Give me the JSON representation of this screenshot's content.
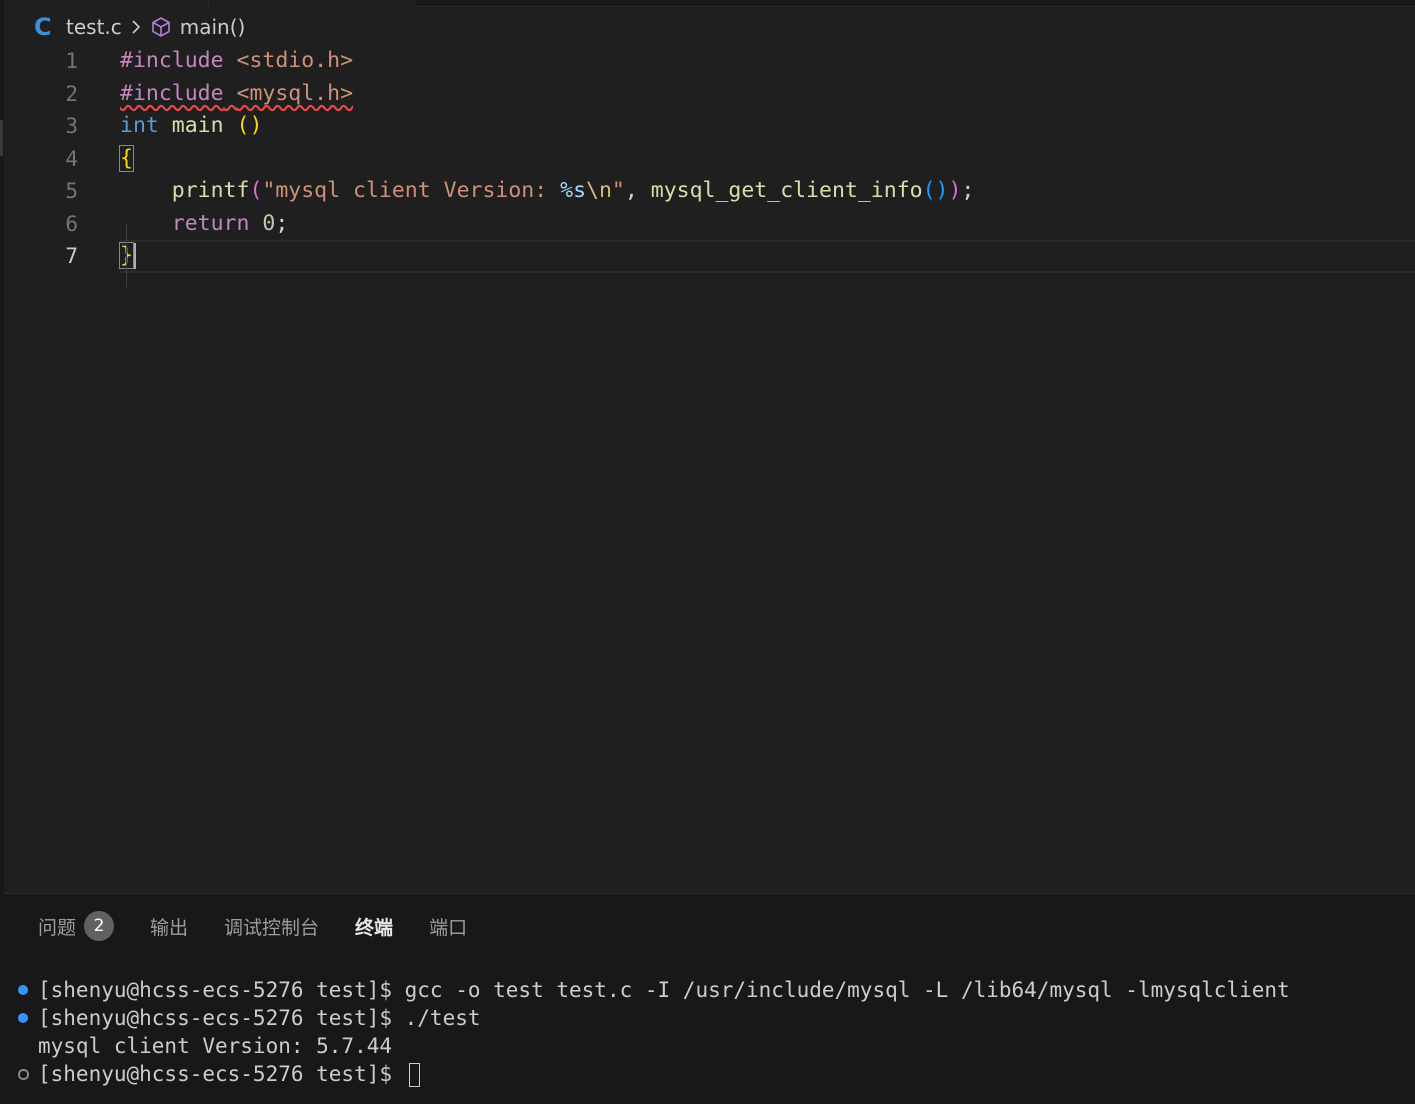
{
  "breadcrumb": {
    "file": "test.c",
    "symbol": "main()",
    "file_icon": "C",
    "separator_icon": "chevron-right-icon",
    "symbol_icon": "cube-icon"
  },
  "editor": {
    "line_numbers": [
      "1",
      "2",
      "3",
      "4",
      "5",
      "6",
      "7"
    ],
    "active_line": "7",
    "lines": {
      "l1": {
        "directive": "#include",
        "space": " ",
        "header": "<stdio.h>"
      },
      "l2": {
        "directive": "#include",
        "space": " ",
        "header": "<mysql.h>"
      },
      "l3": {
        "type": "int",
        "space": " ",
        "name": "main",
        "space2": " ",
        "parens": "()"
      },
      "l4": {
        "brace": "{"
      },
      "l5": {
        "indent": "    ",
        "fn": "printf",
        "open": "(",
        "str_a": "\"mysql client Version: ",
        "fmt": "%s",
        "esc": "\\n",
        "str_b": "\"",
        "comma": ", ",
        "call": "mysql_get_client_info",
        "call_parens": "()",
        "close": ")",
        "semi": ";"
      },
      "l6": {
        "indent": "    ",
        "kw": "return",
        "space": " ",
        "num": "0",
        "semi": ";"
      },
      "l7": {
        "brace": "}"
      }
    }
  },
  "panel": {
    "tabs": [
      {
        "label": "问题",
        "badge": "2"
      },
      {
        "label": "输出"
      },
      {
        "label": "调试控制台"
      },
      {
        "label": "终端"
      },
      {
        "label": "端口"
      }
    ],
    "active_tab": "终端"
  },
  "terminal": {
    "lines": [
      {
        "text": "[shenyu@hcss-ecs-5276 test]$ gcc -o test test.c -I /usr/include/mysql -L /lib64/mysql -lmysqlclient",
        "marker": "blue"
      },
      {
        "text": "[shenyu@hcss-ecs-5276 test]$ ./test",
        "marker": "blue"
      },
      {
        "text": "mysql client Version: 5.7.44",
        "marker": "none"
      },
      {
        "text": "[shenyu@hcss-ecs-5276 test]$ ",
        "marker": "hollow"
      }
    ]
  },
  "colors": {
    "editor_bg": "#1f1f1f",
    "panel_bg": "#181818",
    "keyword_blue": "#569cd6",
    "preprocessor": "#c586c0",
    "string": "#ce9178",
    "function": "#dcdcaa",
    "decoration_blue": "#3794ff",
    "error_squiggle": "#f14c4c"
  }
}
